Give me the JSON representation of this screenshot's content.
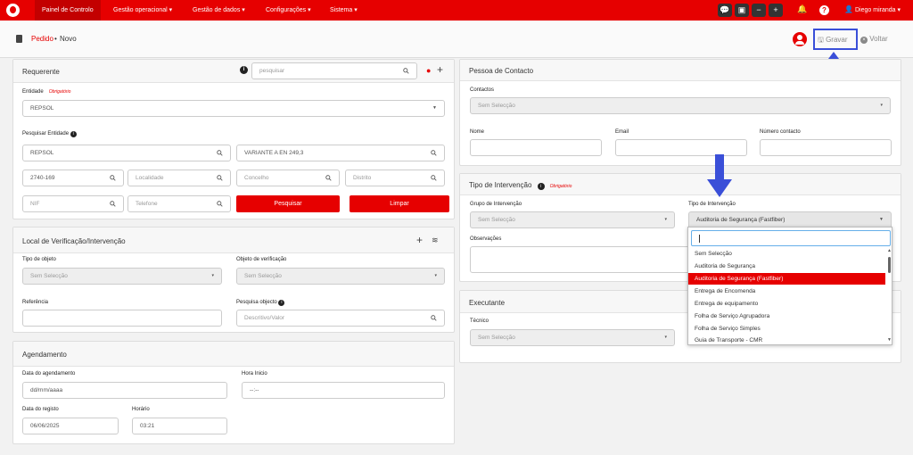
{
  "topbar": {
    "menu": [
      {
        "label": "Painel de Controlo"
      },
      {
        "label": "Gestão operacional ▾"
      },
      {
        "label": "Gestão de dados ▾"
      },
      {
        "label": "Configurações ▾"
      },
      {
        "label": "Sistema ▾"
      }
    ],
    "user": "Diego miranda ▾"
  },
  "header": {
    "breadcrumb_link": "Pedido",
    "breadcrumb_sep": "•",
    "breadcrumb_current": "Novo",
    "save_label": "Gravar",
    "back_label": "Voltar"
  },
  "requerente": {
    "title": "Requerente",
    "search_placeholder": "pesquisar",
    "entidade_label": "Entidade",
    "required": "Obrigatório",
    "entidade_value": "REPSOL",
    "pesquisar_entidade_label": "Pesquisar Entidade",
    "fields": {
      "entidade": "REPSOL",
      "morada": "VARIANTE A EN 249,3",
      "codpostal": "2740-169",
      "localidade": "Localidade",
      "concelho": "Concelho",
      "distrito": "Distrito",
      "nif": "NIF",
      "telefone": "Telefone"
    },
    "btn_pesquisar": "Pesquisar",
    "btn_limpar": "Limpar"
  },
  "local": {
    "title": "Local de Verificação/Intervenção",
    "tipo_objeto_label": "Tipo de objeto",
    "tipo_objeto_value": "Sem Selecção",
    "objeto_verif_label": "Objeto de verificação",
    "objeto_verif_value": "Sem Selecção",
    "referencia_label": "Referência",
    "pesquisa_objeto_label": "Pesquisa objecto",
    "pesquisa_objeto_placeholder": "Descritivo/Valor"
  },
  "agendamento": {
    "title": "Agendamento",
    "data_agendamento_label": "Data do agendamento",
    "data_agendamento_value": "dd/mm/aaaa",
    "hora_inicio_label": "Hora Inicio",
    "hora_inicio_value": "--:--",
    "data_registo_label": "Data do registo",
    "data_registo_value": "06/06/2025",
    "horario_label": "Horário",
    "horario_value": "03:21"
  },
  "contacto": {
    "title": "Pessoa de Contacto",
    "contactos_label": "Contactos",
    "contactos_value": "Sem Selecção",
    "nome_label": "Nome",
    "email_label": "Email",
    "numero_label": "Número contacto"
  },
  "intervencao": {
    "title": "Tipo de Intervenção",
    "required": "Obrigatório",
    "grupo_label": "Grupo de Intervenção",
    "grupo_value": "Sem Selecção",
    "tipo_label": "Tipo de Intervenção",
    "tipo_value": "Auditoria de Segurança (Fastfiber)",
    "observacoes_label": "Observações"
  },
  "executante": {
    "title": "Executante",
    "tecnico_label": "Técnico",
    "tecnico_value": "Sem Selecção"
  },
  "dropdown": {
    "options": [
      "Sem Selecção",
      "Auditoria de Segurança",
      "Auditoria de Segurança (Fastfiber)",
      "Entrega de Encomenda",
      "Entrega de equipamento",
      "Folha de Serviço Agrupadora",
      "Folha de Serviço Simples",
      "Guia de Transporte - CMR"
    ],
    "selected_index": 2
  },
  "colors": {
    "brand": "#e60000",
    "annotation": "#3a4fd8"
  }
}
